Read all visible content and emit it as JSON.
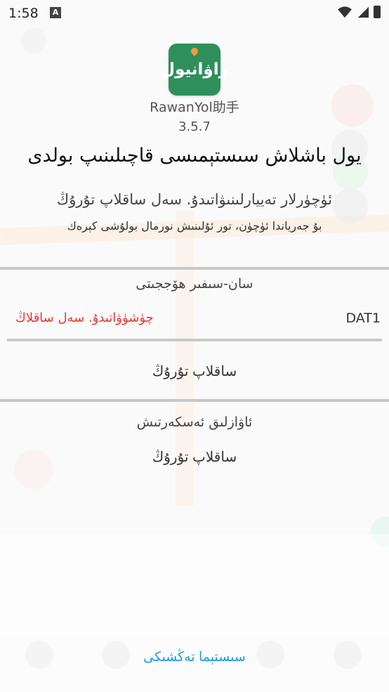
{
  "status_bar": {
    "time": "1:58",
    "notification_letter": "A"
  },
  "app": {
    "logo_text": "راۋانيول",
    "name": "RawanYol助手",
    "version": "3.5.7"
  },
  "title": "يول باشلاش سىستېمىسى قاچىلىنىپ بولدى",
  "messages": {
    "line1": "ئۈچۈرلار تەييارلىنىۋاتىدۇ. سەل ساقلاپ تۇرۇڭ",
    "line2": "بۇ جەرياندا ئۈچۈن، تور ئۇلىنىش نورمال بولۇشى كېرەك"
  },
  "device_section": {
    "label": "سان-سىفىر ھۆججىتى",
    "status_text": "چۈشۈۋاتىدۇ. سەل ساقلاڭ",
    "device_name": "DAT1",
    "wait_button": "ساقلاپ تۇرۇڭ"
  },
  "voice_section": {
    "label": "ئاۋازلىق ئەسكەرتىش",
    "wait_button": "ساقلاپ تۇرۇڭ"
  },
  "bottom": {
    "settings_link": "سىستېما تەڭشىكى"
  },
  "colors": {
    "accent": "#1e9be6",
    "error": "#e53935",
    "logo_bg": "#2f8f5c"
  }
}
